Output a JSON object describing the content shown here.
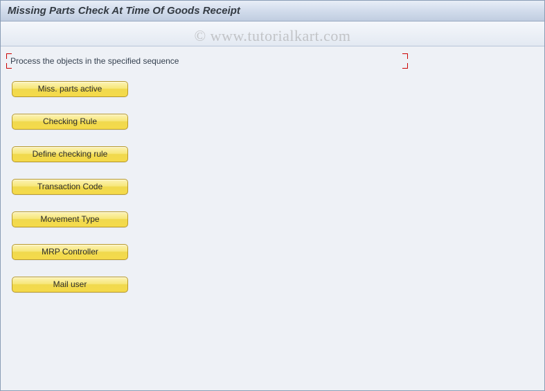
{
  "header": {
    "title": "Missing Parts Check At Time Of Goods Receipt"
  },
  "instruction": {
    "text": "Process the objects in the specified sequence"
  },
  "buttons": [
    {
      "label": "Miss. parts active"
    },
    {
      "label": "Checking Rule"
    },
    {
      "label": "Define checking rule"
    },
    {
      "label": "Transaction Code"
    },
    {
      "label": "Movement Type"
    },
    {
      "label": "MRP Controller"
    },
    {
      "label": "Mail user"
    }
  ],
  "watermark": {
    "text": "© www.tutorialkart.com"
  }
}
